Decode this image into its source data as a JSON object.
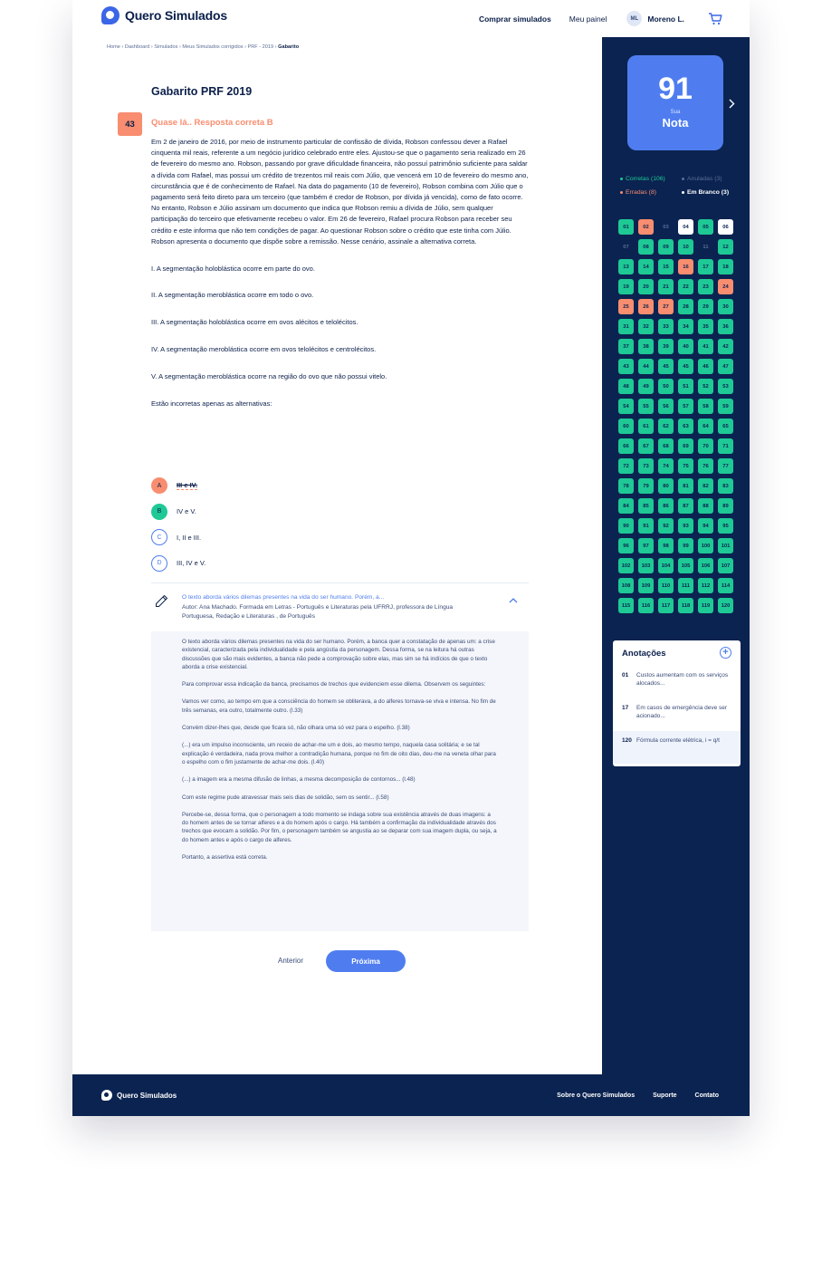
{
  "brand": {
    "name": "Quero Simulados"
  },
  "nav": {
    "buy": "Comprar simulados",
    "panel": "Meu painel",
    "user_initials": "ML",
    "user_name": "Moreno L."
  },
  "breadcrumb": [
    "Home",
    "Dashboard",
    "Simulados",
    "Meus Simulados corrigidos",
    "PRF - 2019",
    "Gabarito"
  ],
  "page": {
    "title": "Gabarito PRF 2019",
    "question_number": "43",
    "status": "Quase lá.. Resposta correta B"
  },
  "question": {
    "text": "Em 2 de janeiro de 2016, por meio de instrumento particular de confissão de dívida, Robson confessou dever a Rafael cinquenta mil reais, referente a um negócio jurídico celebrado entre eles. Ajustou-se que o pagamento seria realizado em 26 de fevereiro do mesmo ano. Robson, passando por grave dificuldade financeira, não possuí patrimônio suficiente para saldar a dívida com Rafael, mas possui um crédito de trezentos mil reais com Júlio, que vencerá em 10 de fevereiro do mesmo ano, circunstância que é de conhecimento de Rafael. Na data do pagamento (10 de fevereiro), Robson combina com Júlio que o pagamento será feito direto para um terceiro (que também é credor de Robson, por dívida já vencida), como de fato ocorre. No entanto, Robson e Júlio assinam um documento que indica que Robson remiu a dívida de Júlio, sem qualquer participação do terceiro que efetivamente recebeu o valor. Em 26 de fevereiro, Rafael procura Robson para receber seu crédito e este informa que não tem condições de pagar. Ao questionar Robson sobre o crédito que este tinha com Júlio. Robson apresenta o documento que dispõe sobre a remissão. Nesse cenário, assinale a alternativa correta.",
    "statements": [
      "I. A segmentação holoblástica ocorre em parte do ovo.",
      "II. A segmentação meroblástica ocorre em todo o ovo.",
      "III. A segmentação holoblástica ocorre em ovos alécitos e telolécitos.",
      "IV. A segmentação meroblástica ocorre em ovos telolécitos e centrolécitos.",
      "V. A segmentação meroblástica ocorre na região do ovo que não possui vitelo."
    ],
    "prompt": "Estão incorretas apenas as alternativas:",
    "options": [
      {
        "letter": "A",
        "text": "III e IV."
      },
      {
        "letter": "B",
        "text": "IV e V."
      },
      {
        "letter": "C",
        "text": "I, II e III."
      },
      {
        "letter": "D",
        "text": "III, IV e V."
      }
    ]
  },
  "explanation": {
    "title": "O texto aborda vários dilemas presentes na vida do ser humano. Porém, a...",
    "author": "Autor: Ana Machado. Formada em Letras - Português e Literaturas pela UFRRJ, professora de Língua Portuguesa, Redação e Literaturas , de Português",
    "paragraphs": [
      "O texto aborda vários dilemas presentes na vida do ser humano. Porém, a banca quer a constatação de apenas um: a crise existencial, caracterizada pela individualidade e pela angústia da personagem. Dessa forma, se na leitura há outras discussões que são mais evidentes, a banca não pede a comprovação sobre elas, mas sim se há indícios de que o texto aborda a crise existencial.",
      "Para comprovar essa indicação da banca, precisamos de trechos que evidenciem esse dilema. Observem os seguintes:",
      "Vamos ver como, ao tempo em que a consciência do homem se obliterava, a do alferes tornava-se viva e intensa. No fim de três semanas, era outro, totalmente outro. (l.33)",
      "Convém dizer-lhes que, desde que ficara só, não olhara uma só vez para o espelho. (l.38)",
      "(...) era um impulso inconsciente, um receio de achar-me um e dois, ao mesmo tempo, naquela casa solitária; e se tal explicação é verdadeira, nada prova melhor a contradição humana, porque no fim de oito dias, deu-me na veneta olhar para o espelho com o fim justamente de achar-me dois. (l.40)",
      "(...) a imagem era a mesma difusão de linhas, a mesma decomposição de contornos... (l.48)",
      "Com este regime pude atravessar mais seis dias de solidão, sem os sentir... (l.58)",
      "Percebe-se, dessa forma, que o personagem a todo momento se indaga sobre sua existência através de duas imagens: a do homem antes de se tornar alferes e a do homem após o cargo. Há também a confirmação da individualidade através dos trechos que evocam a solidão. Por fim, o personagem também se angustia ao se deparar com sua imagem dupla, ou seja, a do homem antes e após o cargo de alferes.",
      "Portanto, a assertiva está correta."
    ]
  },
  "pager": {
    "prev": "Anterior",
    "next": "Próxima"
  },
  "score": {
    "value": "91",
    "sua": "Sua",
    "label": "Nota"
  },
  "legend": {
    "correct": "Corretas (106)",
    "annulled": "Anuladas (3)",
    "wrong": "Erradas (8)",
    "blank": "Em Branco (3)"
  },
  "colors": {
    "correct": "#1ec995",
    "wrong": "#f88d6f",
    "annulled": "#5a6e96",
    "blank": "#ffffff",
    "accent": "#4f7df0",
    "navy": "#0b2350"
  },
  "answers": [
    {
      "n": "01",
      "s": "c"
    },
    {
      "n": "02",
      "s": "w"
    },
    {
      "n": "03",
      "s": "n"
    },
    {
      "n": "04",
      "s": "b"
    },
    {
      "n": "05",
      "s": "c"
    },
    {
      "n": "06",
      "s": "b"
    },
    {
      "n": "07",
      "s": "n"
    },
    {
      "n": "08",
      "s": "c"
    },
    {
      "n": "09",
      "s": "c"
    },
    {
      "n": "10",
      "s": "c"
    },
    {
      "n": "11",
      "s": "n"
    },
    {
      "n": "12",
      "s": "c"
    },
    {
      "n": "13",
      "s": "c"
    },
    {
      "n": "14",
      "s": "c"
    },
    {
      "n": "15",
      "s": "c"
    },
    {
      "n": "16",
      "s": "w"
    },
    {
      "n": "17",
      "s": "c"
    },
    {
      "n": "18",
      "s": "c"
    },
    {
      "n": "19",
      "s": "c"
    },
    {
      "n": "20",
      "s": "c"
    },
    {
      "n": "21",
      "s": "c"
    },
    {
      "n": "22",
      "s": "c"
    },
    {
      "n": "23",
      "s": "c"
    },
    {
      "n": "24",
      "s": "w"
    },
    {
      "n": "25",
      "s": "w"
    },
    {
      "n": "26",
      "s": "w"
    },
    {
      "n": "27",
      "s": "w"
    },
    {
      "n": "28",
      "s": "c"
    },
    {
      "n": "29",
      "s": "c"
    },
    {
      "n": "30",
      "s": "c"
    },
    {
      "n": "31",
      "s": "c"
    },
    {
      "n": "32",
      "s": "c"
    },
    {
      "n": "33",
      "s": "c"
    },
    {
      "n": "34",
      "s": "c"
    },
    {
      "n": "35",
      "s": "c"
    },
    {
      "n": "36",
      "s": "c"
    },
    {
      "n": "37",
      "s": "c"
    },
    {
      "n": "38",
      "s": "c"
    },
    {
      "n": "39",
      "s": "c"
    },
    {
      "n": "40",
      "s": "c"
    },
    {
      "n": "41",
      "s": "c"
    },
    {
      "n": "42",
      "s": "c"
    },
    {
      "n": "43",
      "s": "c"
    },
    {
      "n": "44",
      "s": "c"
    },
    {
      "n": "45",
      "s": "c"
    },
    {
      "n": "45",
      "s": "c"
    },
    {
      "n": "46",
      "s": "c"
    },
    {
      "n": "47",
      "s": "c"
    },
    {
      "n": "48",
      "s": "c"
    },
    {
      "n": "49",
      "s": "c"
    },
    {
      "n": "50",
      "s": "c"
    },
    {
      "n": "51",
      "s": "c"
    },
    {
      "n": "52",
      "s": "c"
    },
    {
      "n": "53",
      "s": "c"
    },
    {
      "n": "54",
      "s": "c"
    },
    {
      "n": "55",
      "s": "c"
    },
    {
      "n": "56",
      "s": "c"
    },
    {
      "n": "57",
      "s": "c"
    },
    {
      "n": "58",
      "s": "c"
    },
    {
      "n": "59",
      "s": "c"
    },
    {
      "n": "60",
      "s": "c"
    },
    {
      "n": "61",
      "s": "c"
    },
    {
      "n": "62",
      "s": "c"
    },
    {
      "n": "63",
      "s": "c"
    },
    {
      "n": "64",
      "s": "c"
    },
    {
      "n": "65",
      "s": "c"
    },
    {
      "n": "66",
      "s": "c"
    },
    {
      "n": "67",
      "s": "c"
    },
    {
      "n": "68",
      "s": "c"
    },
    {
      "n": "69",
      "s": "c"
    },
    {
      "n": "70",
      "s": "c"
    },
    {
      "n": "71",
      "s": "c"
    },
    {
      "n": "72",
      "s": "c"
    },
    {
      "n": "73",
      "s": "c"
    },
    {
      "n": "74",
      "s": "c"
    },
    {
      "n": "75",
      "s": "c"
    },
    {
      "n": "76",
      "s": "c"
    },
    {
      "n": "77",
      "s": "c"
    },
    {
      "n": "78",
      "s": "c"
    },
    {
      "n": "79",
      "s": "c"
    },
    {
      "n": "80",
      "s": "c"
    },
    {
      "n": "81",
      "s": "c"
    },
    {
      "n": "82",
      "s": "c"
    },
    {
      "n": "83",
      "s": "c"
    },
    {
      "n": "84",
      "s": "c"
    },
    {
      "n": "85",
      "s": "c"
    },
    {
      "n": "86",
      "s": "c"
    },
    {
      "n": "87",
      "s": "c"
    },
    {
      "n": "88",
      "s": "c"
    },
    {
      "n": "89",
      "s": "c"
    },
    {
      "n": "90",
      "s": "c"
    },
    {
      "n": "91",
      "s": "c"
    },
    {
      "n": "92",
      "s": "c"
    },
    {
      "n": "93",
      "s": "c"
    },
    {
      "n": "94",
      "s": "c"
    },
    {
      "n": "95",
      "s": "c"
    },
    {
      "n": "96",
      "s": "c"
    },
    {
      "n": "97",
      "s": "c"
    },
    {
      "n": "98",
      "s": "c"
    },
    {
      "n": "99",
      "s": "c"
    },
    {
      "n": "100",
      "s": "c"
    },
    {
      "n": "101",
      "s": "c"
    },
    {
      "n": "102",
      "s": "c"
    },
    {
      "n": "103",
      "s": "c"
    },
    {
      "n": "104",
      "s": "c"
    },
    {
      "n": "105",
      "s": "c"
    },
    {
      "n": "106",
      "s": "c"
    },
    {
      "n": "107",
      "s": "c"
    },
    {
      "n": "108",
      "s": "c"
    },
    {
      "n": "109",
      "s": "c"
    },
    {
      "n": "110",
      "s": "c"
    },
    {
      "n": "111",
      "s": "c"
    },
    {
      "n": "112",
      "s": "c"
    },
    {
      "n": "114",
      "s": "c"
    },
    {
      "n": "115",
      "s": "c"
    },
    {
      "n": "116",
      "s": "c"
    },
    {
      "n": "117",
      "s": "c"
    },
    {
      "n": "118",
      "s": "c"
    },
    {
      "n": "119",
      "s": "c"
    },
    {
      "n": "120",
      "s": "c"
    }
  ],
  "notes": {
    "title": "Anotações",
    "items": [
      {
        "n": "01",
        "text": "Custos aumentam com os serviços alocados..."
      },
      {
        "n": "17",
        "text": "Em casos de emergência deve ser acionado..."
      },
      {
        "n": "120",
        "text": "Fórmula corrente elétrica, i = q/t"
      }
    ]
  },
  "footer": {
    "brand": "Quero Simulados",
    "links": [
      "Sobre o Quero Simulados",
      "Suporte",
      "Contato"
    ]
  }
}
